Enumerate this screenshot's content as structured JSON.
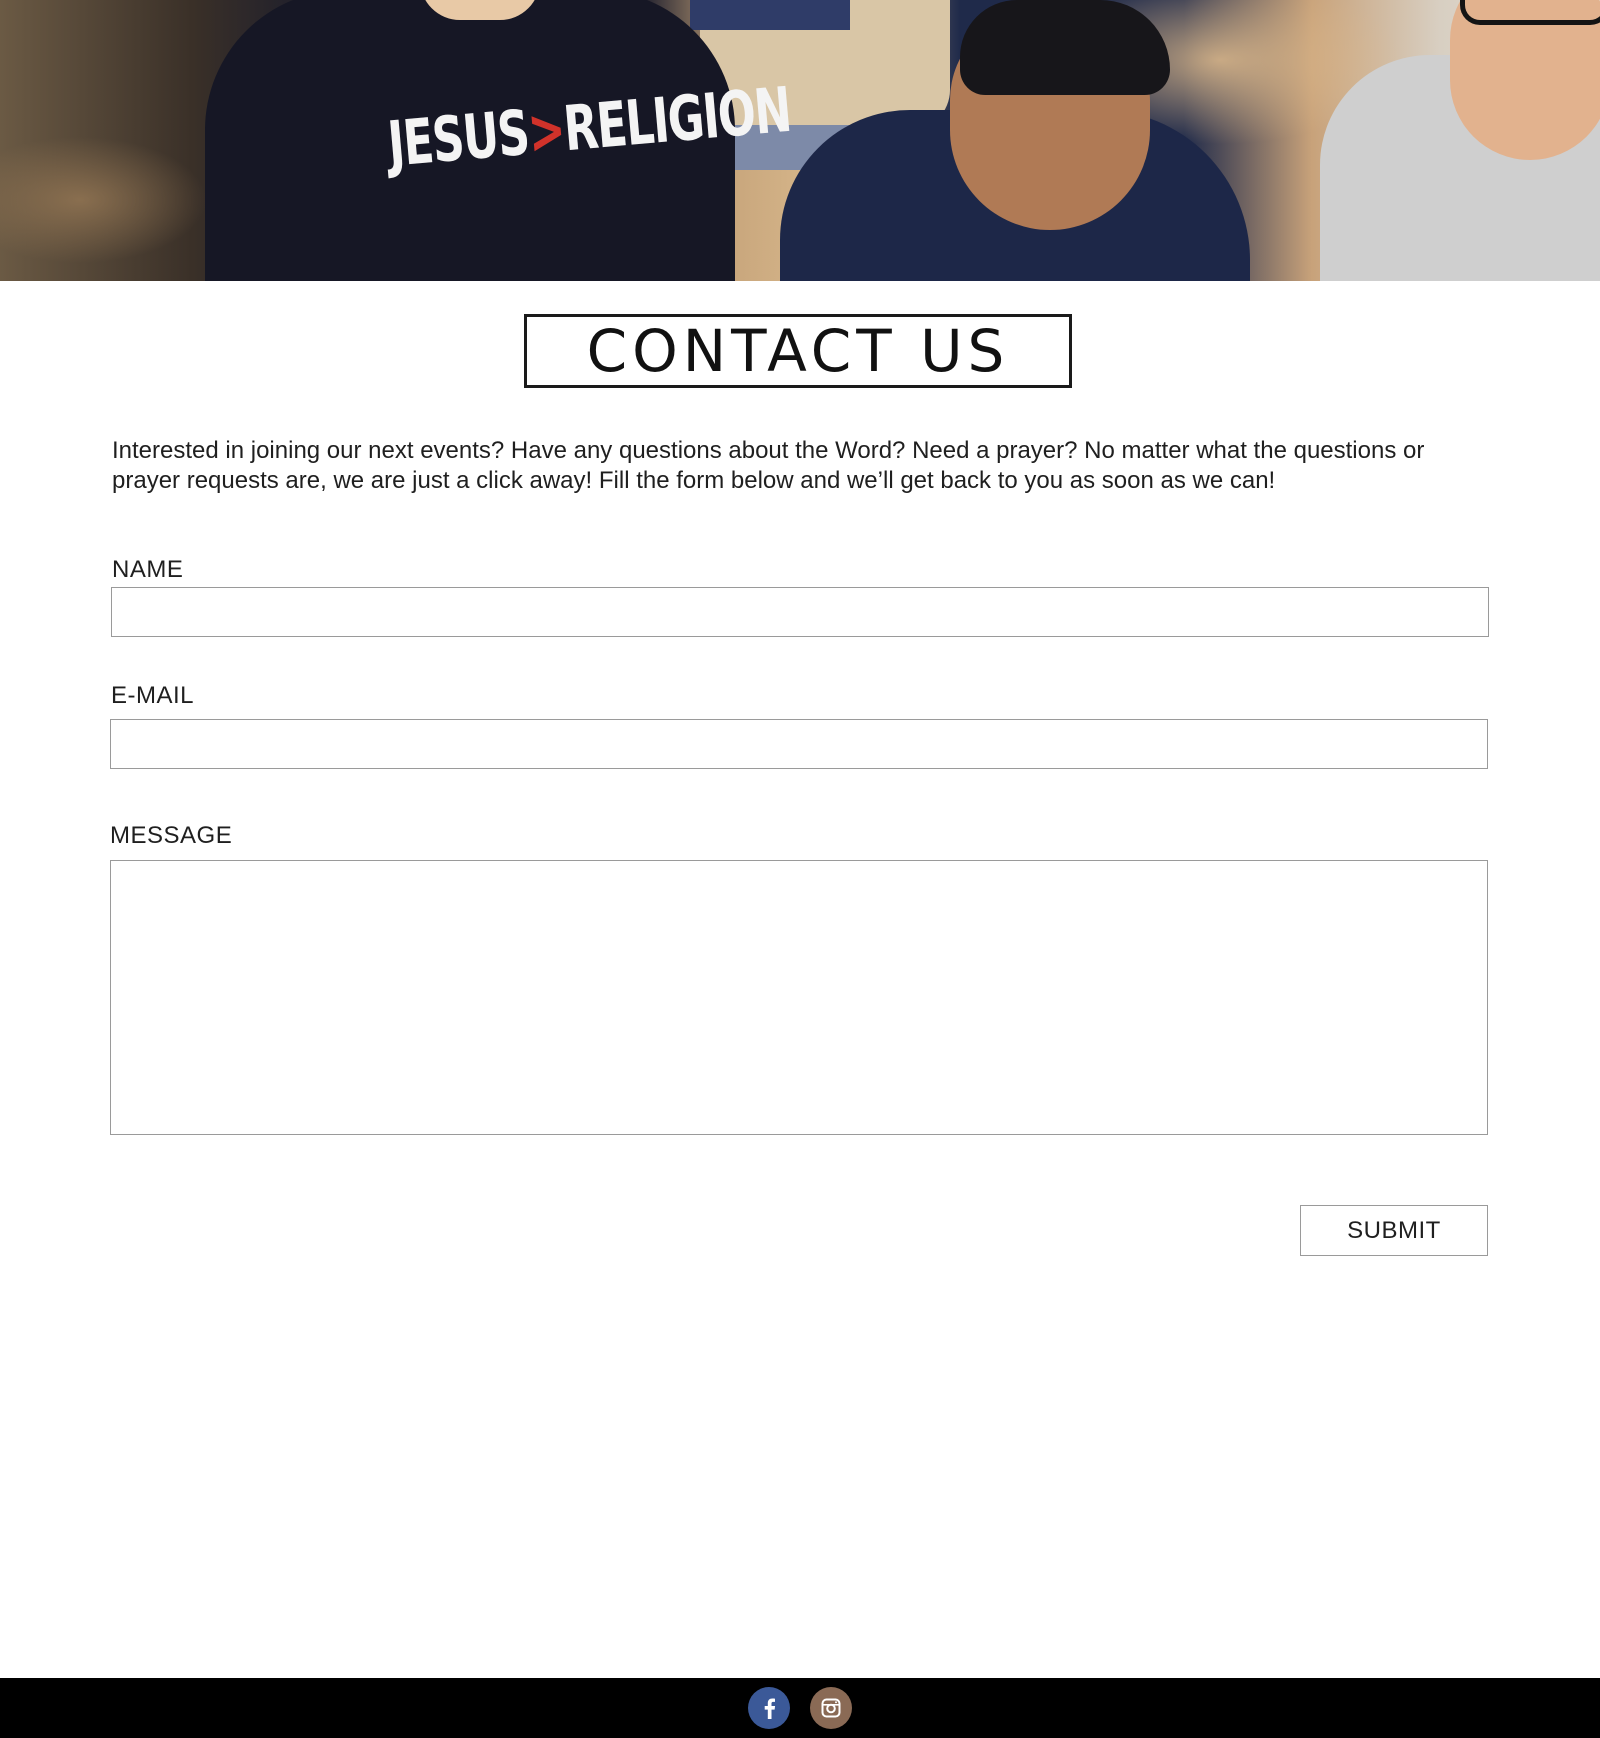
{
  "hero": {
    "shirt_text_left": "JESUS",
    "shirt_text_symbol": ">",
    "shirt_text_right": "RELIGION"
  },
  "page": {
    "title": "CONTACT US",
    "intro": "Interested in joining our next events? Have any questions about the Word? Need a prayer? No matter what the questions or prayer requests are, we are just a click away! Fill the form below and we’ll get back to you as soon as we can!"
  },
  "form": {
    "name_label": "NAME",
    "name_value": "",
    "email_label": "E-MAIL",
    "email_value": "",
    "message_label": "MESSAGE",
    "message_value": "",
    "submit_label": "SUBMIT"
  },
  "footer": {
    "social": [
      {
        "icon": "facebook-icon",
        "color": "#3b5998"
      },
      {
        "icon": "instagram-icon",
        "color": "#8a6a55"
      }
    ]
  }
}
